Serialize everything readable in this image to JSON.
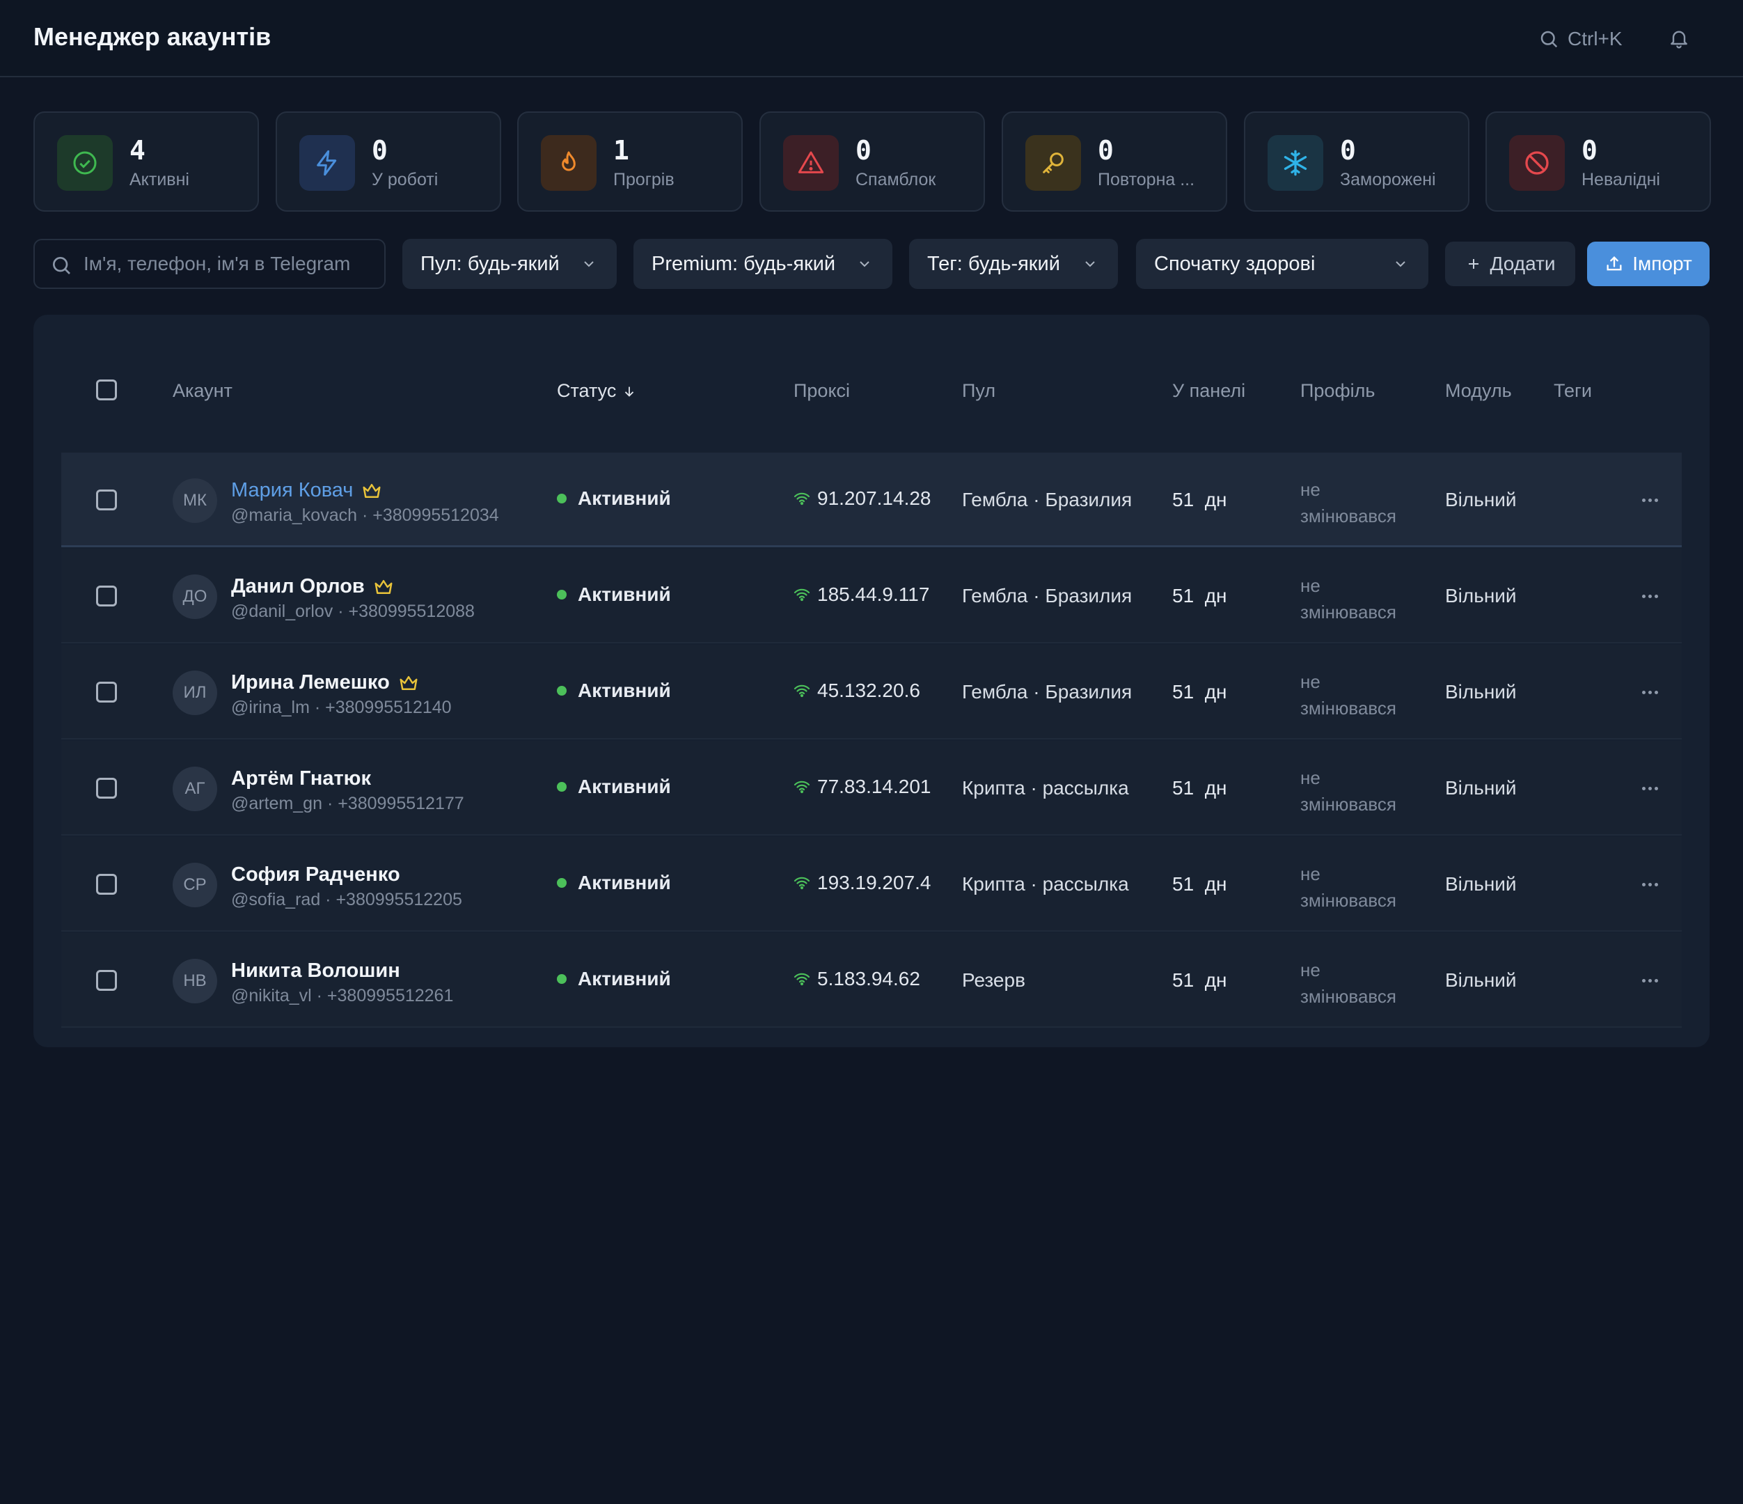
{
  "header": {
    "title": "Менеджер акаунтів",
    "search_shortcut": "Ctrl+K"
  },
  "stats": [
    {
      "value": "4",
      "label": "Активні",
      "icon": "check-circle-icon",
      "color": "#3fb950"
    },
    {
      "value": "0",
      "label": "У роботі",
      "icon": "lightning-icon",
      "color": "#4a8fdc"
    },
    {
      "value": "1",
      "label": "Прогрів",
      "icon": "flame-icon",
      "color": "#f08a2c"
    },
    {
      "value": "0",
      "label": "Спамблок",
      "icon": "warning-triangle-icon",
      "color": "#e5484d"
    },
    {
      "value": "0",
      "label": "Повторна ...",
      "icon": "key-icon",
      "color": "#e0b43a"
    },
    {
      "value": "0",
      "label": "Заморожені",
      "icon": "snowflake-icon",
      "color": "#2fb3e8"
    },
    {
      "value": "0",
      "label": "Невалідні",
      "icon": "ban-icon",
      "color": "#e5484d"
    }
  ],
  "toolbar": {
    "search_placeholder": "Ім'я, телефон, ім'я в Telegram",
    "pool_filter": "Пул: будь-який",
    "premium_filter": "Premium: будь-який",
    "tag_filter": "Тег: будь-який",
    "sort": "Спочатку здорові",
    "add_label": "Додати",
    "import_label": "Імпорт"
  },
  "table": {
    "columns": [
      "Акаунт",
      "Статус",
      "Проксі",
      "Пул",
      "У панелі",
      "Профіль",
      "Модуль",
      "Теги"
    ],
    "rows": [
      {
        "initials": "МК",
        "name": "Мария Ковач",
        "premium": true,
        "sub": "@maria_kovach · +380995512034",
        "status": "Активний",
        "proxy": "91.207.14.28",
        "pool": "Гембла · Бразилия",
        "days": "51  дн",
        "profile_line1": "не",
        "profile_line2": "змінювався",
        "module": "Вільний"
      },
      {
        "initials": "ДО",
        "name": "Данил Орлов",
        "premium": true,
        "sub": "@danil_orlov · +380995512088",
        "status": "Активний",
        "proxy": "185.44.9.117",
        "pool": "Гембла · Бразилия",
        "days": "51  дн",
        "profile_line1": "не",
        "profile_line2": "змінювався",
        "module": "Вільний"
      },
      {
        "initials": "ИЛ",
        "name": "Ирина Лемешко",
        "premium": true,
        "sub": "@irina_lm · +380995512140",
        "status": "Активний",
        "proxy": "45.132.20.6",
        "pool": "Гембла · Бразилия",
        "days": "51  дн",
        "profile_line1": "не",
        "profile_line2": "змінювався",
        "module": "Вільний"
      },
      {
        "initials": "АГ",
        "name": "Артём Гнатюк",
        "premium": false,
        "sub": "@artem_gn · +380995512177",
        "status": "Активний",
        "proxy": "77.83.14.201",
        "pool": "Крипта · рассылка",
        "days": "51  дн",
        "profile_line1": "не",
        "profile_line2": "змінювався",
        "module": "Вільний"
      },
      {
        "initials": "СР",
        "name": "София Радченко",
        "premium": false,
        "sub": "@sofia_rad · +380995512205",
        "status": "Активний",
        "proxy": "193.19.207.4",
        "pool": "Крипта · рассылка",
        "days": "51  дн",
        "profile_line1": "не",
        "profile_line2": "змінювався",
        "module": "Вільний"
      },
      {
        "initials": "НВ",
        "name": "Никита Волошин",
        "premium": false,
        "sub": "@nikita_vl · +380995512261",
        "status": "Активний",
        "proxy": "5.183.94.62",
        "pool": "Резерв",
        "days": "51  дн",
        "profile_line1": "не",
        "profile_line2": "змінювався",
        "module": "Вільний"
      }
    ]
  }
}
